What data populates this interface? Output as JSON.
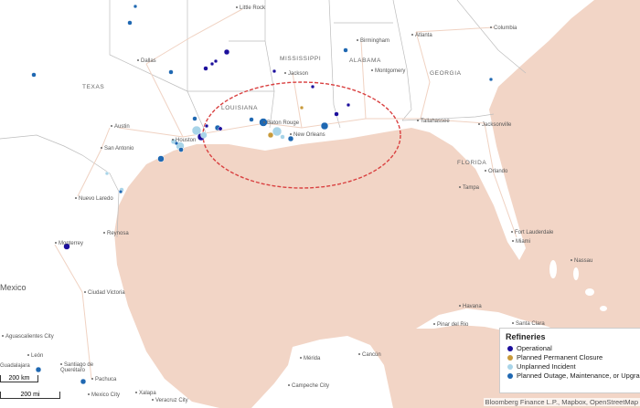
{
  "colors": {
    "water": "#f2d5c6",
    "land": "#ffffff",
    "border": "#bdbdbd",
    "road": "#f0d2c2",
    "operational": "#1c0f9c",
    "planned_closure": "#c89a3a",
    "unplanned_incident": "#a8d4e8",
    "planned_outage": "#1f68b2",
    "highlight": "#d94040"
  },
  "countries": [
    "Mexico"
  ],
  "states": [
    "TEXAS",
    "LOUISIANA",
    "MISSISSIPPI",
    "ALABAMA",
    "GEORGIA",
    "FLORIDA"
  ],
  "cities": [
    "Little Rock",
    "Atlanta",
    "Columbia",
    "Dallas",
    "Birmingham",
    "Jackson",
    "Montgomery",
    "Austin",
    "Baton Rouge",
    "New Orleans",
    "Tallahassee",
    "Jacksonville",
    "San Antonio",
    "Houston",
    "Orlando",
    "Nuevo Laredo",
    "Tampa",
    "Reynosa",
    "Fort Lauderdale",
    "Miami",
    "Monterrey",
    "Nassau",
    "Ciudad Victoria",
    "Havana",
    "Pinar del Rio",
    "Santa Clara",
    "Aguascalientes City",
    "León",
    "Guadalajara",
    "Santiago de Querétaro",
    "Pachuca",
    "Mexico City",
    "Xalapa",
    "Veracruz City",
    "Mérida",
    "Cancún",
    "Campeche City"
  ],
  "legend": {
    "title": "Refineries",
    "items": [
      {
        "label": "Operational",
        "status": "operational"
      },
      {
        "label": "Planned Permanent Closure",
        "status": "planned_closure"
      },
      {
        "label": "Unplanned Incident",
        "status": "unplanned_incident"
      },
      {
        "label": "Planned Outage, Maintenance, or Upgrade",
        "status": "planned_outage"
      }
    ]
  },
  "scale": {
    "km": "200 km",
    "mi": "200 mi"
  },
  "attribution": "Bloomberg Finance L.P., Mapbox, OpenStreetMap"
}
